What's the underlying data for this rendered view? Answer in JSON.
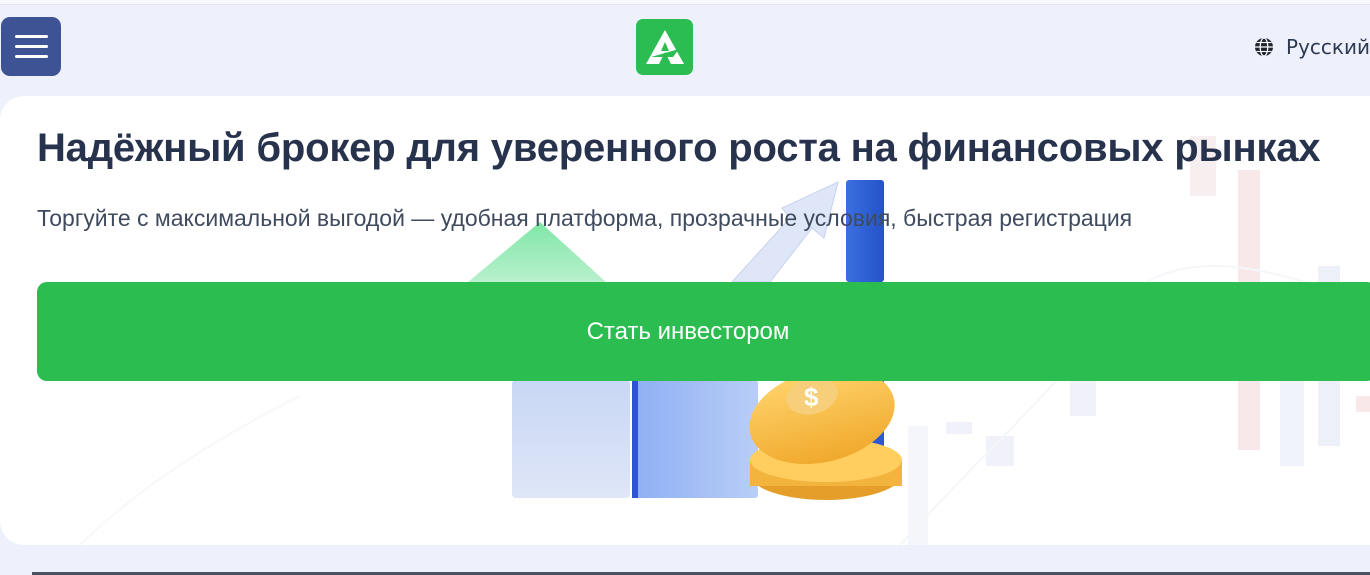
{
  "header": {
    "menu_icon": "hamburger-menu-icon",
    "logo_icon": "brand-logo-icon",
    "language": {
      "icon": "globe-icon",
      "label": "Русский"
    }
  },
  "hero": {
    "title": "Надёжный брокер для уверенного роста на финансовых рынках",
    "subtitle": "Торгуйте с максимальной выгодой — удобная платформа, прозрачные условия, быстрая регистрация",
    "cta_label": "Стать инвестором"
  },
  "colors": {
    "menu_bg": "#3d5394",
    "brand_green": "#2bbd52",
    "cta_green": "#2bbd4f",
    "title": "#27324d",
    "page_bg": "#eef1fb"
  }
}
